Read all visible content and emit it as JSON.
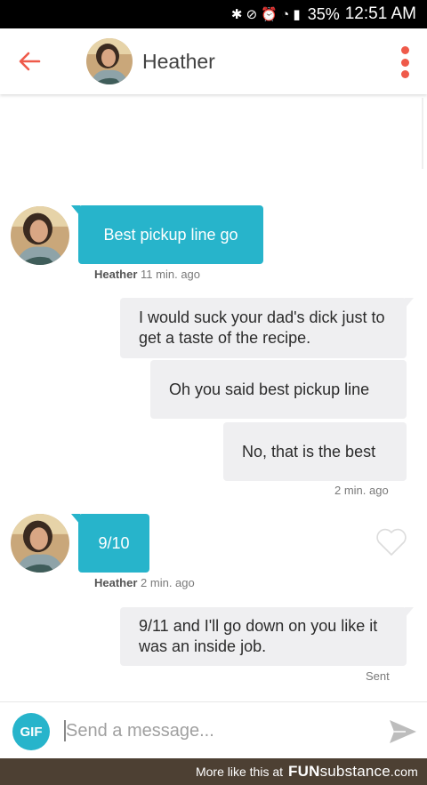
{
  "status_bar": {
    "icons": "✱ ⊘ ⏰ ◔ ▮",
    "battery": "35%",
    "time": "12:51 AM"
  },
  "header": {
    "contact_name": "Heather",
    "accent_color": "#ef5a4a"
  },
  "messages": [
    {
      "sender": "them",
      "text": "Best pickup line go",
      "meta_name": "Heather",
      "meta_time": "11 min. ago"
    },
    {
      "sender": "me",
      "text": "I would suck your dad's dick just to get a taste of the recipe."
    },
    {
      "sender": "me",
      "text": "Oh you said best pickup line"
    },
    {
      "sender": "me",
      "text": "No, that is the best",
      "meta_time": "2 min. ago"
    },
    {
      "sender": "them",
      "text": "9/10",
      "meta_name": "Heather",
      "meta_time": "2 min. ago"
    },
    {
      "sender": "me",
      "text": "9/11 and I'll go down on you like it was an inside job.",
      "status": "Sent"
    }
  ],
  "composer": {
    "gif_label": "GIF",
    "placeholder": "Send a message..."
  },
  "footer": {
    "text": "More like this at",
    "brand_fun": "FUN",
    "brand_rest": "substance",
    "brand_tld": ".com"
  },
  "colors": {
    "incoming_bubble": "#27b4cb",
    "outgoing_bubble": "#efeff1",
    "footer_bg": "#4d4033"
  }
}
